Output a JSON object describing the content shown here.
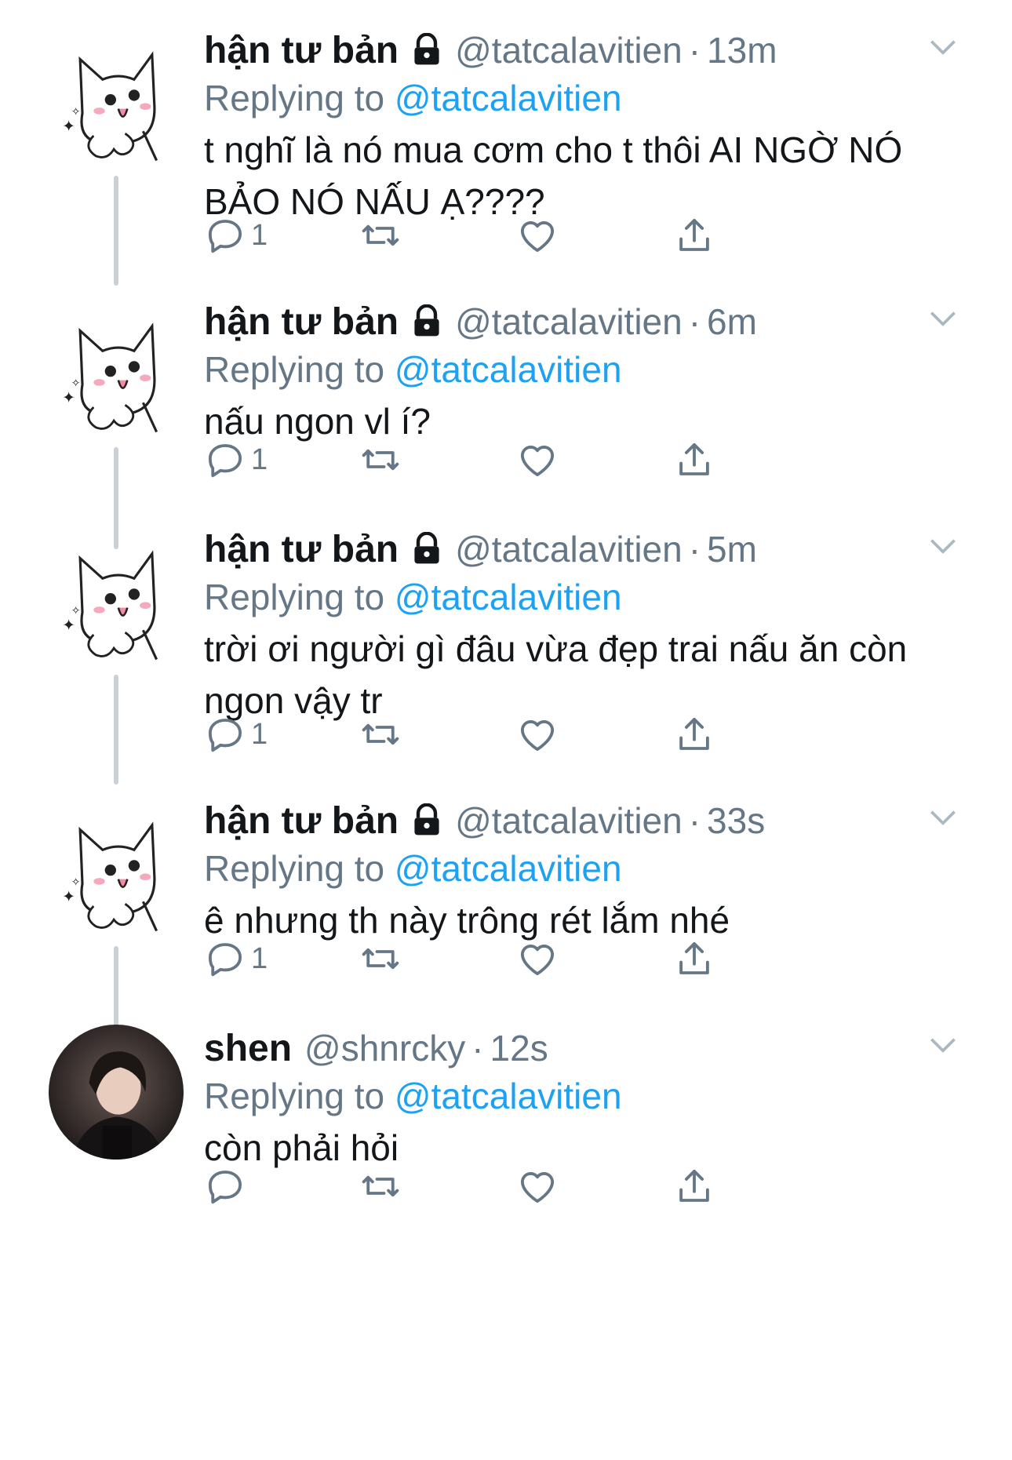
{
  "colors": {
    "accent": "#1da1f2",
    "secondary": "#657786",
    "text": "#14171a",
    "thread_line": "#c9d0d6"
  },
  "tweets": [
    {
      "name": "hận tư bản",
      "handle": "@tatcalavitien",
      "time": "13m",
      "dot": "·",
      "replying_label": "Replying to",
      "replying_to": "@tatcalavitien",
      "text": "t nghĩ là nó mua cơm cho t thôi AI NGỜ NÓ BẢO NÓ NẤU Ạ????",
      "reply_count": "1",
      "protected": true
    },
    {
      "name": "hận tư bản",
      "handle": "@tatcalavitien",
      "time": "6m",
      "dot": "·",
      "replying_label": "Replying to",
      "replying_to": "@tatcalavitien",
      "text": "nấu ngon vl í?",
      "reply_count": "1",
      "protected": true
    },
    {
      "name": "hận tư bản",
      "handle": "@tatcalavitien",
      "time": "5m",
      "dot": "·",
      "replying_label": "Replying to",
      "replying_to": "@tatcalavitien",
      "text": "trời ơi người gì đâu vừa đẹp trai nấu ăn còn ngon vậy tr",
      "reply_count": "1",
      "protected": true
    },
    {
      "name": "hận tư bản",
      "handle": "@tatcalavitien",
      "time": "33s",
      "dot": "·",
      "replying_label": "Replying to",
      "replying_to": "@tatcalavitien",
      "text": "ê nhưng th này trông rét lắm nhé",
      "reply_count": "1",
      "protected": true
    },
    {
      "name": "shen",
      "handle": "@shnrcky",
      "time": "12s",
      "dot": "·",
      "replying_label": "Replying to",
      "replying_to": "@tatcalavitien",
      "text": "còn phải hỏi",
      "reply_count": "",
      "protected": false
    }
  ],
  "icons": {
    "reply": "reply-icon",
    "retweet": "retweet-icon",
    "like": "heart-icon",
    "share": "share-icon",
    "more": "chevron-down-icon",
    "lock": "lock-icon"
  }
}
